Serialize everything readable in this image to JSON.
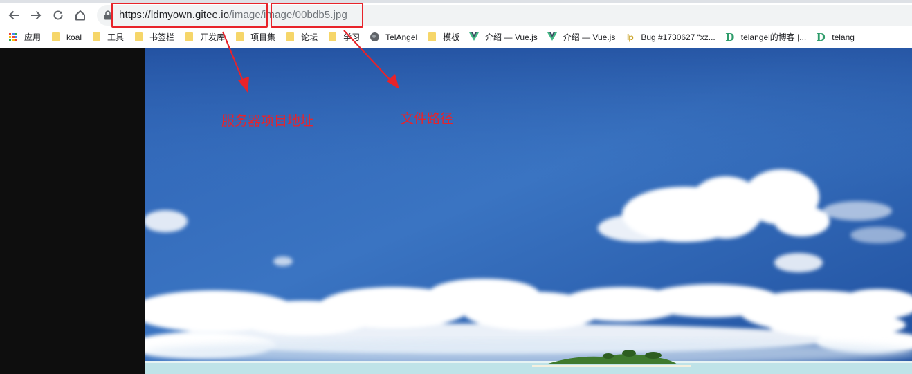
{
  "address_bar": {
    "url_host": "https://ldmyown.gitee.io",
    "url_path": "/image/image/00bdb5.jpg"
  },
  "bookmarks": [
    {
      "label": "应用",
      "icon": "apps-grid-icon"
    },
    {
      "label": "koal",
      "icon": "folder-icon"
    },
    {
      "label": "工具",
      "icon": "folder-icon"
    },
    {
      "label": "书签栏",
      "icon": "folder-icon"
    },
    {
      "label": "开发库",
      "icon": "folder-icon"
    },
    {
      "label": "项目集",
      "icon": "folder-icon"
    },
    {
      "label": "论坛",
      "icon": "folder-icon"
    },
    {
      "label": "学习",
      "icon": "folder-icon"
    },
    {
      "label": "TelAngel",
      "icon": "globe-icon"
    },
    {
      "label": "模板",
      "icon": "folder-icon"
    },
    {
      "label": "介绍 — Vue.js",
      "icon": "vue-logo-icon"
    },
    {
      "label": "介绍 — Vue.js",
      "icon": "vue-logo-icon"
    },
    {
      "label": "Bug #1730627 “xz...",
      "icon": "launchpad-icon"
    },
    {
      "label": "telangel的博客 |...",
      "icon": "d-logo-icon"
    },
    {
      "label": "telang",
      "icon": "d-logo-icon"
    }
  ],
  "annotations": {
    "server_label": "服务器项目地址",
    "path_label": "文件路径",
    "color": "#e8232a"
  },
  "colors": {
    "sky_top": "#1f4f9e",
    "sky_mid": "#3d78c4",
    "sea": "#bfe3e8"
  }
}
